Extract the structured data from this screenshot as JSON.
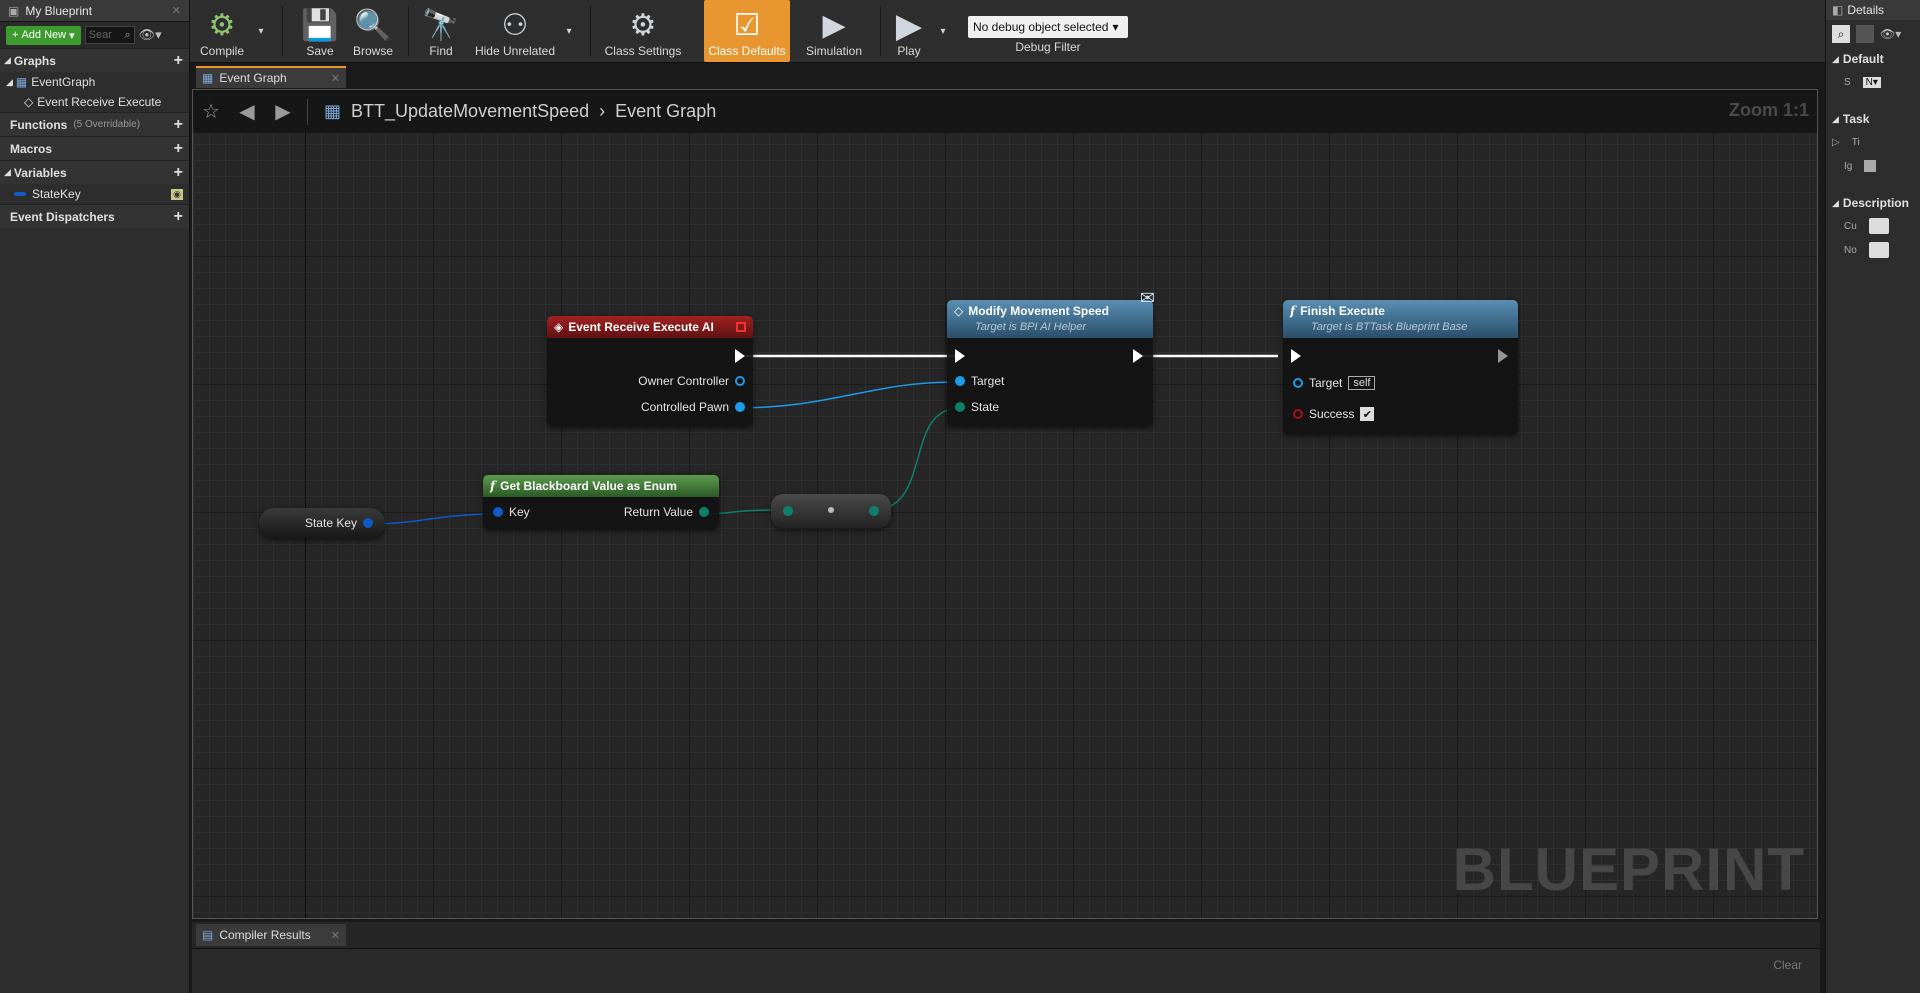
{
  "left_panel": {
    "tab_title": "My Blueprint",
    "add_new_label": "Add New",
    "search_placeholder": "Sear",
    "sections": {
      "graphs": "Graphs",
      "functions": "Functions",
      "functions_sub": "(5 Overridable)",
      "macros": "Macros",
      "variables": "Variables",
      "event_dispatchers": "Event Dispatchers"
    },
    "graph_items": [
      "EventGraph",
      "Event Receive Execute"
    ],
    "variable_items": [
      "StateKey"
    ]
  },
  "toolbar": {
    "compile": "Compile",
    "save": "Save",
    "browse": "Browse",
    "find": "Find",
    "hide_unrelated": "Hide Unrelated",
    "class_settings": "Class Settings",
    "class_defaults": "Class Defaults",
    "simulation": "Simulation",
    "play": "Play",
    "debug_select": "No debug object selected",
    "debug_label": "Debug Filter"
  },
  "graph_tab": {
    "label": "Event Graph"
  },
  "graph": {
    "breadcrumb_blueprint": "BTT_UpdateMovementSpeed",
    "breadcrumb_graph": "Event Graph",
    "zoom": "Zoom 1:1",
    "watermark": "BLUEPRINT",
    "nodes": {
      "event": {
        "title": "Event Receive Execute AI",
        "pins": [
          "Owner Controller",
          "Controlled Pawn"
        ]
      },
      "modify": {
        "title": "Modify Movement Speed",
        "subtitle": "Target is BPI AI Helper",
        "pins": [
          "Target",
          "State"
        ]
      },
      "finish": {
        "title": "Finish Execute",
        "subtitle": "Target is BTTask Blueprint Base",
        "pins": [
          "Target",
          "Success"
        ],
        "self_tag": "self"
      },
      "blackboard": {
        "title": "Get Blackboard Value as Enum",
        "pins": [
          "Key",
          "Return Value"
        ]
      },
      "state_key": {
        "title": "State Key"
      }
    },
    "colors": {
      "event_head": "#8c1c1c",
      "function_head": "#1f5a7c",
      "pure_head": "#2f6b2a",
      "object_pin": "#1e9be8",
      "enum_pin": "#0f7f6c",
      "struct_pin": "#1258c6",
      "bool_pin": "#a80f0f"
    }
  },
  "bottom": {
    "tab_label": "Compiler Results",
    "clear_label": "Clear"
  },
  "right_panel": {
    "tab_title": "Details",
    "sections": [
      "Default",
      "Task",
      "Description"
    ],
    "rows": {
      "default_s": "S",
      "default_n": "N",
      "task_ti": "Ti",
      "task_ig": "Ig",
      "desc_cu": "Cu",
      "desc_no": "No"
    }
  }
}
